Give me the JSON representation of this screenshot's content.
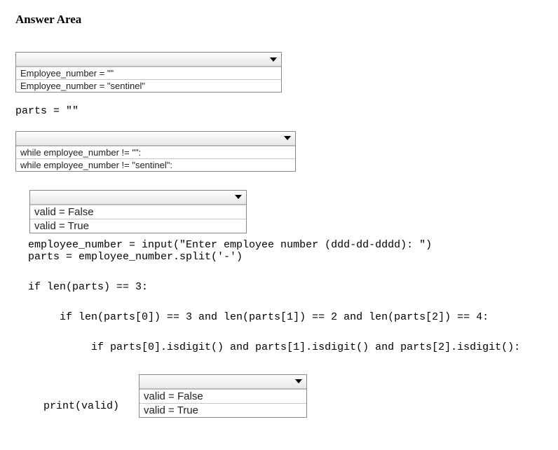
{
  "title": "Answer Area",
  "dropdown1": {
    "options": [
      "Employee_number = \"\"",
      "Employee_number = \"sentinel\""
    ]
  },
  "code1": "parts = \"\"",
  "dropdown2": {
    "options": [
      "while employee_number != \"\":",
      "while employee_number != \"sentinel\":"
    ]
  },
  "dropdown3": {
    "options": [
      "valid = False",
      "valid = True"
    ]
  },
  "code2_line1": "  employee_number = input(\"Enter employee number (ddd-dd-dddd): \")",
  "code2_line2": "  parts = employee_number.split('-')",
  "code3": "  if len(parts) == 3:",
  "code4": "       if len(parts[0]) == 3 and len(parts[1]) == 2 and len(parts[2]) == 4:",
  "code5": "            if parts[0].isdigit() and parts[1].isdigit() and parts[2].isdigit():",
  "dropdown4": {
    "options": [
      "valid = False",
      "valid = True"
    ]
  },
  "print_line": "print(valid)"
}
